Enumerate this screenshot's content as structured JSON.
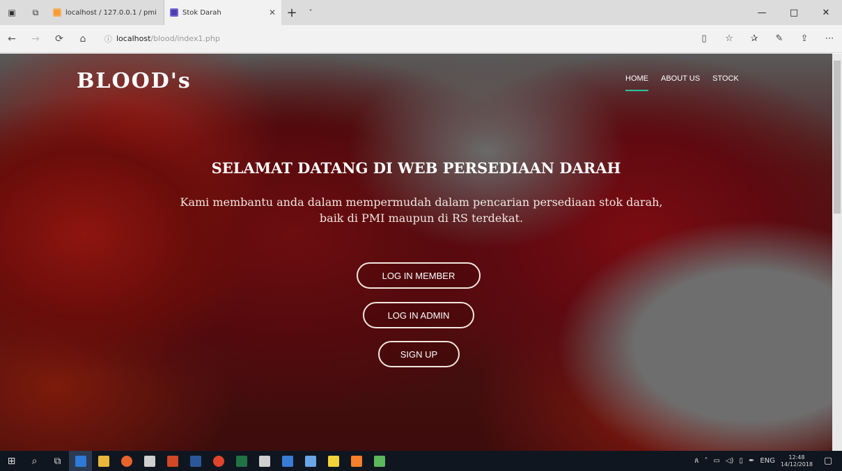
{
  "browser": {
    "tabs": [
      {
        "title": "localhost / 127.0.0.1 / pmi /",
        "active": false,
        "favicon_color": "#f39c33"
      },
      {
        "title": "Stok Darah",
        "active": true,
        "favicon_color": "#4e3cb0"
      }
    ],
    "url_host": "localhost",
    "url_path": "/blood/index1.php",
    "icons": {
      "tab_actions": "tab-actions-icon",
      "set_aside": "set-aside-tabs-icon",
      "new_tab": "+",
      "tab_menu": "˅",
      "back": "←",
      "forward": "→",
      "refresh": "⟳",
      "home": "⌂",
      "reading": "▯",
      "favorite": "☆",
      "favorites_hub": "✰",
      "notes": "✎",
      "share": "⇪",
      "more": "⋯",
      "minimize": "—",
      "maximize": "□",
      "close": "✕"
    }
  },
  "site": {
    "logo": "BLOOD's",
    "nav": [
      {
        "label": "HOME",
        "active": true
      },
      {
        "label": "ABOUT US",
        "active": false
      },
      {
        "label": "STOCK",
        "active": false
      }
    ],
    "headline": "SELAMAT DATANG DI WEB PERSEDIAAN DARAH",
    "subtitle_line1": "Kami membantu anda dalam mempermudah dalam pencarian persediaan stok darah,",
    "subtitle_line2": "baik di PMI maupun di RS terdekat.",
    "buttons": {
      "member": "LOG IN MEMBER",
      "admin": "LOG IN ADMIN",
      "signup": "SIGN UP"
    },
    "accent_color": "#2ec4a0"
  },
  "taskbar": {
    "apps": [
      {
        "name": "windows-start",
        "color": "#ffffff"
      },
      {
        "name": "search",
        "color": "#ffffff"
      },
      {
        "name": "task-view",
        "color": "#ffffff"
      },
      {
        "name": "edge",
        "color": "#2f7ad6"
      },
      {
        "name": "file-explorer",
        "color": "#e8b73a"
      },
      {
        "name": "firefox",
        "color": "#e8642a"
      },
      {
        "name": "store",
        "color": "#cfcfcf"
      },
      {
        "name": "powerpoint",
        "color": "#d24726"
      },
      {
        "name": "word",
        "color": "#2b579a"
      },
      {
        "name": "chrome",
        "color": "#e0442c"
      },
      {
        "name": "excel",
        "color": "#217346"
      },
      {
        "name": "network-drive",
        "color": "#cfcfcf"
      },
      {
        "name": "app-blue",
        "color": "#3a7bd5"
      },
      {
        "name": "app-monitor",
        "color": "#6aa5e8"
      },
      {
        "name": "sticky",
        "color": "#f2d33a"
      },
      {
        "name": "xampp",
        "color": "#f57f2a"
      },
      {
        "name": "app-green",
        "color": "#5cb85c"
      }
    ],
    "lang": "ENG",
    "time": "12:48",
    "date": "14/12/2018"
  }
}
